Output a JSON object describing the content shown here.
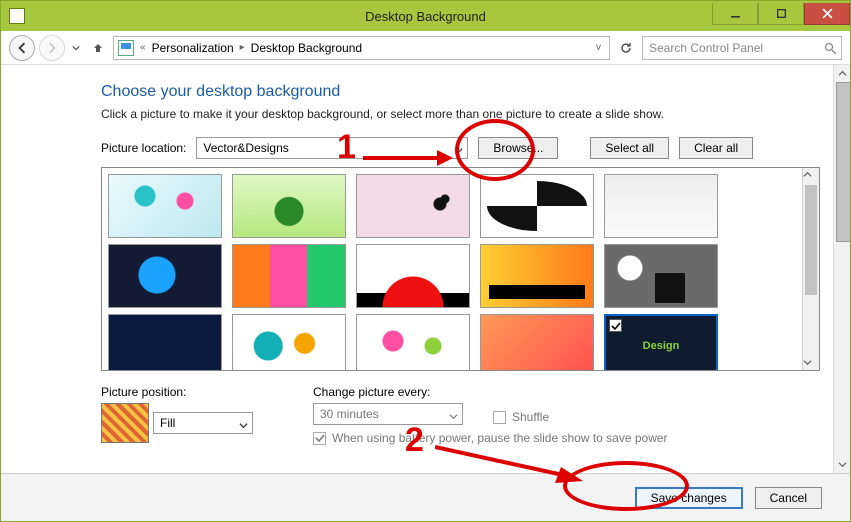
{
  "window": {
    "title": "Desktop Background"
  },
  "caption": {
    "min": "Minimize",
    "max": "Maximize",
    "close": "Close"
  },
  "nav": {
    "back": "Back",
    "forward": "Forward",
    "up": "Up",
    "breadcrumb": [
      "«",
      "Personalization",
      "Desktop Background"
    ],
    "refresh": "Refresh"
  },
  "search": {
    "placeholder": "Search Control Panel"
  },
  "heading": "Choose your desktop background",
  "subheading": "Click a picture to make it your desktop background, or select more than one picture to create a slide show.",
  "location": {
    "label": "Picture location:",
    "selected": "Vector&Designs",
    "browse": "Browse...",
    "select_all": "Select all",
    "clear_all": "Clear all"
  },
  "thumbs": {
    "count": 15,
    "selected_index": 14,
    "selected_text": "Design"
  },
  "position": {
    "label": "Picture position:",
    "selected": "Fill"
  },
  "interval": {
    "label": "Change picture every:",
    "selected": "30 minutes",
    "shuffle": "Shuffle",
    "battery": "When using battery power, pause the slide show to save power"
  },
  "footer": {
    "save": "Save changes",
    "cancel": "Cancel"
  },
  "annotations": {
    "one": "1",
    "two": "2"
  }
}
